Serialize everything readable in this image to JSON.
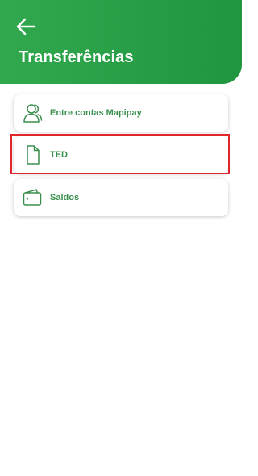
{
  "header": {
    "title": "Transferências",
    "back_icon": "arrow-left-icon",
    "background_color": "#2a9e47"
  },
  "options": [
    {
      "label": "Entre contas Mapipay",
      "icon": "users-icon"
    },
    {
      "label": "TED",
      "icon": "document-icon"
    },
    {
      "label": "Saldos",
      "icon": "wallet-icon"
    }
  ],
  "highlight": {
    "target": "TED",
    "color": "#e0252b"
  },
  "colors": {
    "accent": "#3a8f4e",
    "card_background": "#ffffff"
  }
}
